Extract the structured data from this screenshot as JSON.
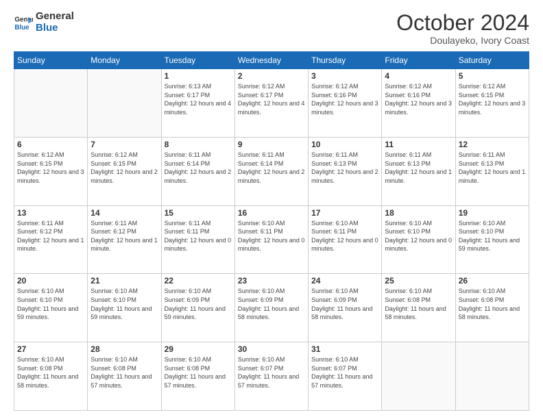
{
  "header": {
    "logo_line1": "General",
    "logo_line2": "Blue",
    "month_year": "October 2024",
    "location": "Doulayeko, Ivory Coast"
  },
  "days_of_week": [
    "Sunday",
    "Monday",
    "Tuesday",
    "Wednesday",
    "Thursday",
    "Friday",
    "Saturday"
  ],
  "weeks": [
    [
      {
        "num": "",
        "sunrise": "",
        "sunset": "",
        "daylight": ""
      },
      {
        "num": "",
        "sunrise": "",
        "sunset": "",
        "daylight": ""
      },
      {
        "num": "1",
        "sunrise": "Sunrise: 6:13 AM",
        "sunset": "Sunset: 6:17 PM",
        "daylight": "Daylight: 12 hours and 4 minutes."
      },
      {
        "num": "2",
        "sunrise": "Sunrise: 6:12 AM",
        "sunset": "Sunset: 6:17 PM",
        "daylight": "Daylight: 12 hours and 4 minutes."
      },
      {
        "num": "3",
        "sunrise": "Sunrise: 6:12 AM",
        "sunset": "Sunset: 6:16 PM",
        "daylight": "Daylight: 12 hours and 3 minutes."
      },
      {
        "num": "4",
        "sunrise": "Sunrise: 6:12 AM",
        "sunset": "Sunset: 6:16 PM",
        "daylight": "Daylight: 12 hours and 3 minutes."
      },
      {
        "num": "5",
        "sunrise": "Sunrise: 6:12 AM",
        "sunset": "Sunset: 6:15 PM",
        "daylight": "Daylight: 12 hours and 3 minutes."
      }
    ],
    [
      {
        "num": "6",
        "sunrise": "Sunrise: 6:12 AM",
        "sunset": "Sunset: 6:15 PM",
        "daylight": "Daylight: 12 hours and 3 minutes."
      },
      {
        "num": "7",
        "sunrise": "Sunrise: 6:12 AM",
        "sunset": "Sunset: 6:15 PM",
        "daylight": "Daylight: 12 hours and 2 minutes."
      },
      {
        "num": "8",
        "sunrise": "Sunrise: 6:11 AM",
        "sunset": "Sunset: 6:14 PM",
        "daylight": "Daylight: 12 hours and 2 minutes."
      },
      {
        "num": "9",
        "sunrise": "Sunrise: 6:11 AM",
        "sunset": "Sunset: 6:14 PM",
        "daylight": "Daylight: 12 hours and 2 minutes."
      },
      {
        "num": "10",
        "sunrise": "Sunrise: 6:11 AM",
        "sunset": "Sunset: 6:13 PM",
        "daylight": "Daylight: 12 hours and 2 minutes."
      },
      {
        "num": "11",
        "sunrise": "Sunrise: 6:11 AM",
        "sunset": "Sunset: 6:13 PM",
        "daylight": "Daylight: 12 hours and 1 minute."
      },
      {
        "num": "12",
        "sunrise": "Sunrise: 6:11 AM",
        "sunset": "Sunset: 6:13 PM",
        "daylight": "Daylight: 12 hours and 1 minute."
      }
    ],
    [
      {
        "num": "13",
        "sunrise": "Sunrise: 6:11 AM",
        "sunset": "Sunset: 6:12 PM",
        "daylight": "Daylight: 12 hours and 1 minute."
      },
      {
        "num": "14",
        "sunrise": "Sunrise: 6:11 AM",
        "sunset": "Sunset: 6:12 PM",
        "daylight": "Daylight: 12 hours and 1 minute."
      },
      {
        "num": "15",
        "sunrise": "Sunrise: 6:11 AM",
        "sunset": "Sunset: 6:11 PM",
        "daylight": "Daylight: 12 hours and 0 minutes."
      },
      {
        "num": "16",
        "sunrise": "Sunrise: 6:10 AM",
        "sunset": "Sunset: 6:11 PM",
        "daylight": "Daylight: 12 hours and 0 minutes."
      },
      {
        "num": "17",
        "sunrise": "Sunrise: 6:10 AM",
        "sunset": "Sunset: 6:11 PM",
        "daylight": "Daylight: 12 hours and 0 minutes."
      },
      {
        "num": "18",
        "sunrise": "Sunrise: 6:10 AM",
        "sunset": "Sunset: 6:10 PM",
        "daylight": "Daylight: 12 hours and 0 minutes."
      },
      {
        "num": "19",
        "sunrise": "Sunrise: 6:10 AM",
        "sunset": "Sunset: 6:10 PM",
        "daylight": "Daylight: 11 hours and 59 minutes."
      }
    ],
    [
      {
        "num": "20",
        "sunrise": "Sunrise: 6:10 AM",
        "sunset": "Sunset: 6:10 PM",
        "daylight": "Daylight: 11 hours and 59 minutes."
      },
      {
        "num": "21",
        "sunrise": "Sunrise: 6:10 AM",
        "sunset": "Sunset: 6:10 PM",
        "daylight": "Daylight: 11 hours and 59 minutes."
      },
      {
        "num": "22",
        "sunrise": "Sunrise: 6:10 AM",
        "sunset": "Sunset: 6:09 PM",
        "daylight": "Daylight: 11 hours and 59 minutes."
      },
      {
        "num": "23",
        "sunrise": "Sunrise: 6:10 AM",
        "sunset": "Sunset: 6:09 PM",
        "daylight": "Daylight: 11 hours and 58 minutes."
      },
      {
        "num": "24",
        "sunrise": "Sunrise: 6:10 AM",
        "sunset": "Sunset: 6:09 PM",
        "daylight": "Daylight: 11 hours and 58 minutes."
      },
      {
        "num": "25",
        "sunrise": "Sunrise: 6:10 AM",
        "sunset": "Sunset: 6:08 PM",
        "daylight": "Daylight: 11 hours and 58 minutes."
      },
      {
        "num": "26",
        "sunrise": "Sunrise: 6:10 AM",
        "sunset": "Sunset: 6:08 PM",
        "daylight": "Daylight: 11 hours and 58 minutes."
      }
    ],
    [
      {
        "num": "27",
        "sunrise": "Sunrise: 6:10 AM",
        "sunset": "Sunset: 6:08 PM",
        "daylight": "Daylight: 11 hours and 58 minutes."
      },
      {
        "num": "28",
        "sunrise": "Sunrise: 6:10 AM",
        "sunset": "Sunset: 6:08 PM",
        "daylight": "Daylight: 11 hours and 57 minutes."
      },
      {
        "num": "29",
        "sunrise": "Sunrise: 6:10 AM",
        "sunset": "Sunset: 6:08 PM",
        "daylight": "Daylight: 11 hours and 57 minutes."
      },
      {
        "num": "30",
        "sunrise": "Sunrise: 6:10 AM",
        "sunset": "Sunset: 6:07 PM",
        "daylight": "Daylight: 11 hours and 57 minutes."
      },
      {
        "num": "31",
        "sunrise": "Sunrise: 6:10 AM",
        "sunset": "Sunset: 6:07 PM",
        "daylight": "Daylight: 11 hours and 57 minutes."
      },
      {
        "num": "",
        "sunrise": "",
        "sunset": "",
        "daylight": ""
      },
      {
        "num": "",
        "sunrise": "",
        "sunset": "",
        "daylight": ""
      }
    ]
  ]
}
